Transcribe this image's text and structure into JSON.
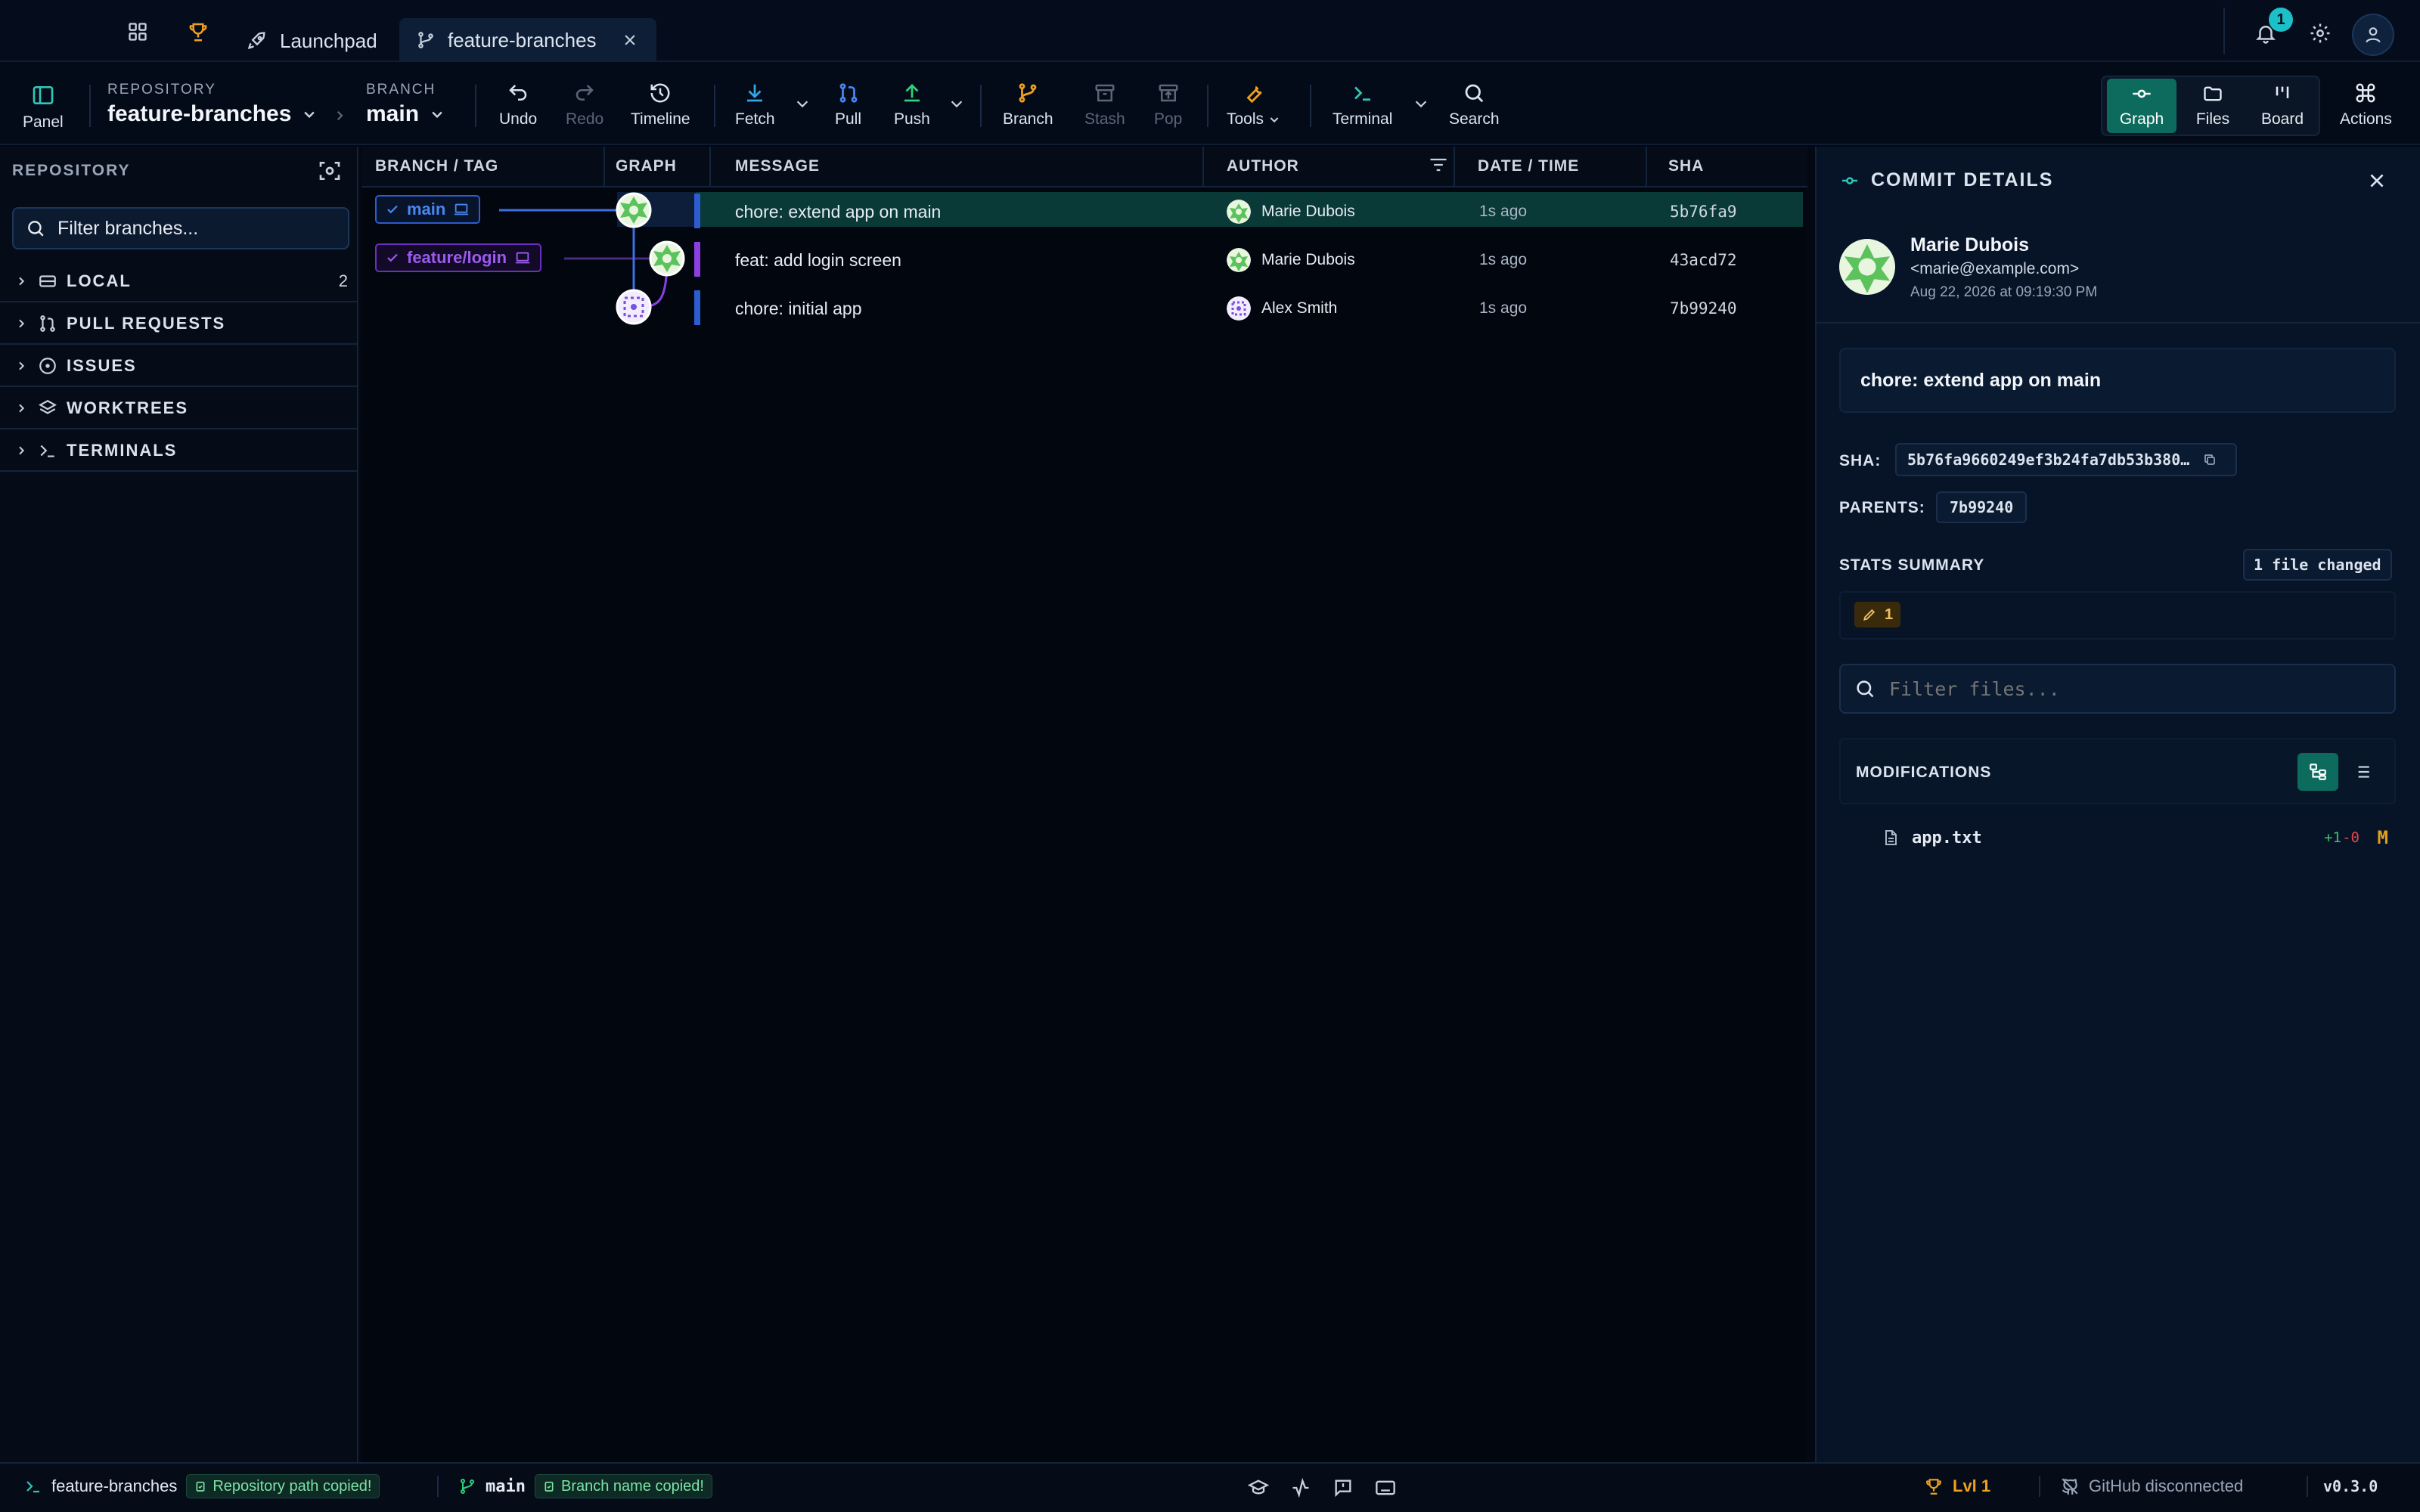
{
  "titlebar": {
    "tabs": [
      {
        "label": "Launchpad"
      },
      {
        "label": "feature-branches"
      }
    ],
    "notification_count": "1"
  },
  "toolbar": {
    "panel_label": "Panel",
    "repo_caption": "REPOSITORY",
    "repo_name": "feature-branches",
    "branch_caption": "BRANCH",
    "branch_name": "main",
    "undo": "Undo",
    "redo": "Redo",
    "timeline": "Timeline",
    "fetch": "Fetch",
    "pull": "Pull",
    "push": "Push",
    "branch": "Branch",
    "stash": "Stash",
    "pop": "Pop",
    "tools": "Tools",
    "terminal": "Terminal",
    "search": "Search",
    "views": [
      {
        "label": "Graph"
      },
      {
        "label": "Files"
      },
      {
        "label": "Board"
      }
    ],
    "actions": "Actions"
  },
  "sidebar": {
    "title": "REPOSITORY",
    "filter_placeholder": "Filter branches...",
    "sections": [
      {
        "label": "LOCAL",
        "count": "2"
      },
      {
        "label": "PULL REQUESTS",
        "count": ""
      },
      {
        "label": "ISSUES",
        "count": ""
      },
      {
        "label": "WORKTREES",
        "count": ""
      },
      {
        "label": "TERMINALS",
        "count": ""
      }
    ]
  },
  "graph": {
    "columns": [
      "BRANCH / TAG",
      "GRAPH",
      "MESSAGE",
      "AUTHOR",
      "DATE / TIME",
      "SHA"
    ],
    "rows": [
      {
        "tag": "main",
        "message": "chore: extend app on main",
        "author": "Marie Dubois",
        "date": "1s ago",
        "sha": "5b76fa9"
      },
      {
        "tag": "feature/login",
        "message": "feat: add login screen",
        "author": "Marie Dubois",
        "date": "1s ago",
        "sha": "43acd72"
      },
      {
        "tag": "",
        "message": "chore: initial app",
        "author": "Alex Smith",
        "date": "1s ago",
        "sha": "7b99240"
      }
    ]
  },
  "details": {
    "title": "COMMIT DETAILS",
    "author_name": "Marie Dubois",
    "author_email": "<marie@example.com>",
    "date": "Aug 22, 2026 at 09:19:30 PM",
    "message": "chore: extend app on main",
    "sha_label": "SHA:",
    "sha_value": "5b76fa9660249ef3b24fa7db53b380…",
    "parents_label": "PARENTS:",
    "parent_value": "7b99240",
    "stats_label": "STATS SUMMARY",
    "files_changed": "1 file changed",
    "modified_count": "1",
    "filter_placeholder": "Filter files...",
    "modifications_label": "MODIFICATIONS",
    "files": [
      {
        "name": "app.txt",
        "added": "+1",
        "removed": "-0",
        "status": "M"
      }
    ]
  },
  "statusbar": {
    "repo": "feature-branches",
    "repo_badge": "Repository path copied!",
    "branch": "main",
    "branch_badge": "Branch name copied!",
    "level": "Lvl 1",
    "github": "GitHub disconnected",
    "version": "v0.3.0"
  },
  "colors": {
    "accent": "#0d6b5e",
    "main_branch": "#3d6fe0",
    "feature_branch": "#8a3fe0",
    "add": "#3fbf6a",
    "remove": "#e04848",
    "modified": "#e0a21c"
  }
}
